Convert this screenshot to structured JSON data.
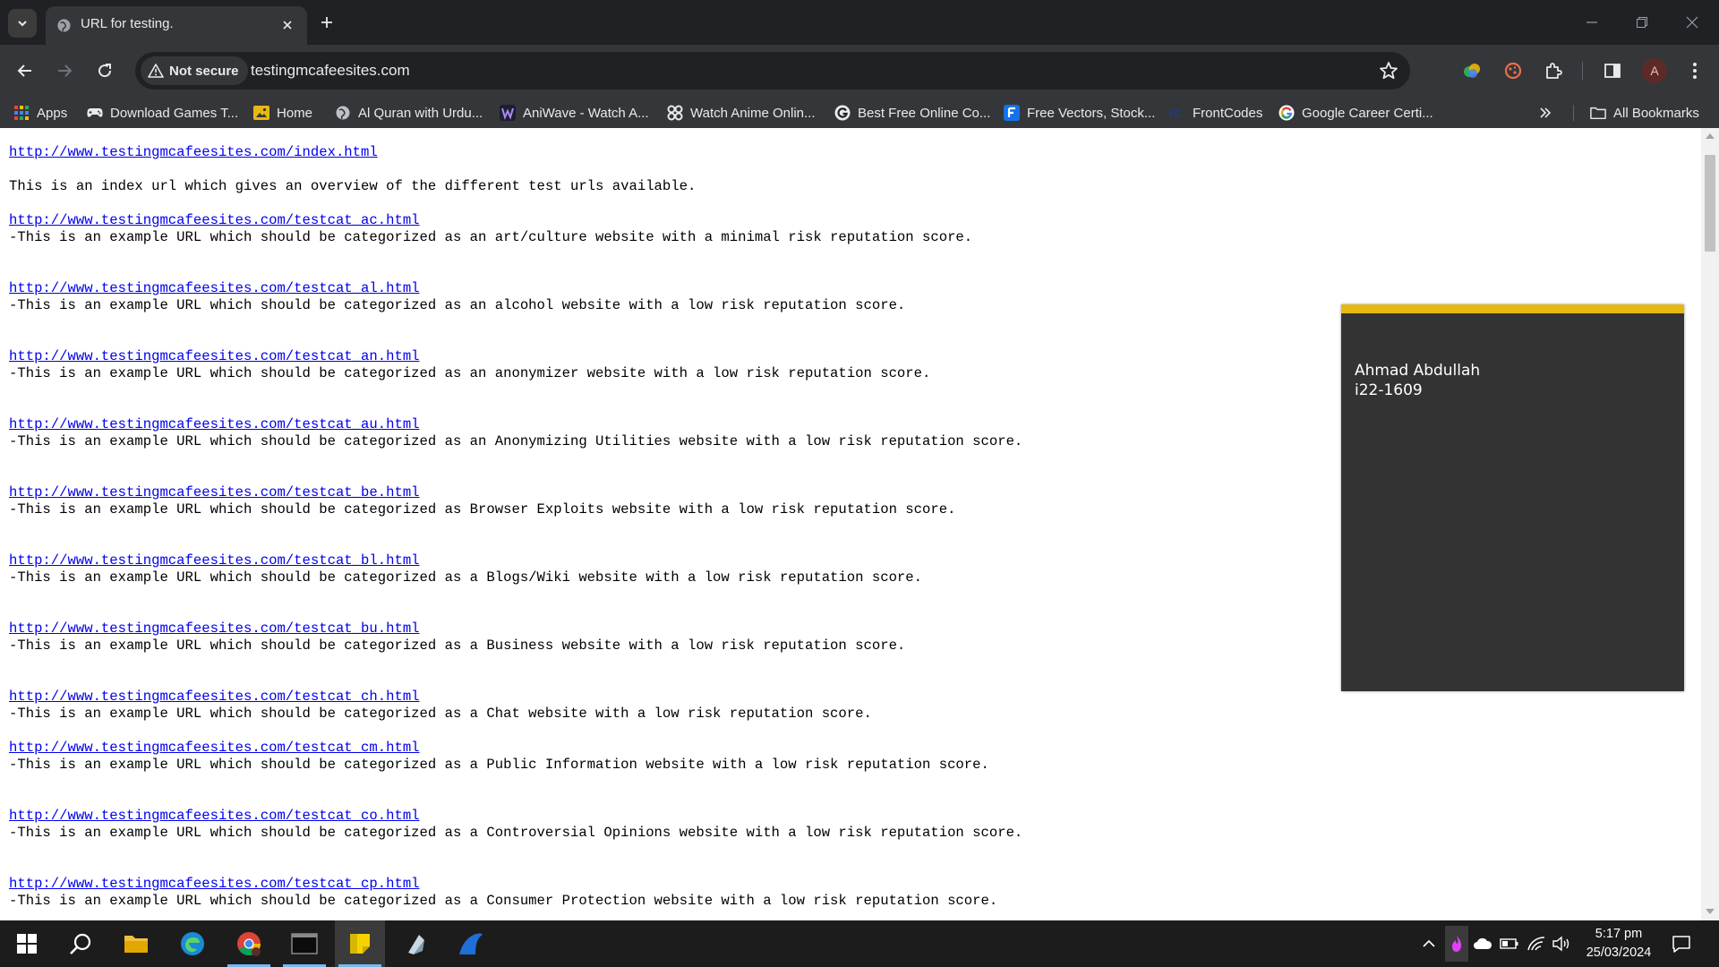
{
  "browser": {
    "tab_title": "URL for testing.",
    "security_chip": "Not secure",
    "url": "testingmcafeesites.com",
    "profile_initial": "A"
  },
  "bookmarks": {
    "items": [
      {
        "label": "Apps",
        "icon": "apps-grid-icon"
      },
      {
        "label": "Download Games T...",
        "icon": "gamepad-icon"
      },
      {
        "label": "Home",
        "icon": "home-image-icon"
      },
      {
        "label": "Al Quran with Urdu...",
        "icon": "globe-icon"
      },
      {
        "label": "AniWave - Watch A...",
        "icon": "aniwave-icon"
      },
      {
        "label": "Watch Anime Onlin...",
        "icon": "anime-icon"
      },
      {
        "label": "Best Free Online Co...",
        "icon": "google-g-icon"
      },
      {
        "label": "Free Vectors, Stock...",
        "icon": "freepik-icon"
      },
      {
        "label": "FrontCodes",
        "icon": "frontcodes-icon"
      },
      {
        "label": "Google Career Certi...",
        "icon": "google-icon"
      }
    ],
    "all_bookmarks": "All Bookmarks"
  },
  "page": {
    "entries": [
      {
        "url": "http://www.testingmcafeesites.com/index.html",
        "desc": "This is an index url which gives an overview of the different test urls available."
      },
      {
        "url": "http://www.testingmcafeesites.com/testcat_ac.html",
        "desc": "-This is an example URL which should be categorized as an art/culture website with a minimal risk reputation score."
      },
      {
        "url": "http://www.testingmcafeesites.com/testcat_al.html",
        "desc": "-This is an example URL which should be categorized as an alcohol website with a low risk reputation score."
      },
      {
        "url": "http://www.testingmcafeesites.com/testcat_an.html",
        "desc": "-This is an example URL which should be categorized as an anonymizer website with a low risk reputation score."
      },
      {
        "url": "http://www.testingmcafeesites.com/testcat_au.html",
        "desc": "-This is an example URL which should be categorized as an Anonymizing Utilities website with a low risk reputation score."
      },
      {
        "url": "http://www.testingmcafeesites.com/testcat_be.html",
        "desc": "-This is an example URL which should be categorized as Browser Exploits website with a low risk reputation score."
      },
      {
        "url": "http://www.testingmcafeesites.com/testcat_bl.html",
        "desc": "-This is an example URL which should be categorized as a Blogs/Wiki website with a low risk reputation score."
      },
      {
        "url": "http://www.testingmcafeesites.com/testcat_bu.html",
        "desc": "-This is an example URL which should be categorized as a Business website with a low risk reputation score."
      },
      {
        "url": "http://www.testingmcafeesites.com/testcat_ch.html",
        "desc": "-This is an example URL which should be categorized as a Chat website with a low risk reputation score."
      },
      {
        "url": "http://www.testingmcafeesites.com/testcat_cm.html",
        "desc": "-This is an example URL which should be categorized as a Public Information website with a low risk reputation score."
      },
      {
        "url": "http://www.testingmcafeesites.com/testcat_co.html",
        "desc": "-This is an example URL which should be categorized as a Controversial Opinions website with a low risk reputation score."
      },
      {
        "url": "http://www.testingmcafeesites.com/testcat_cp.html",
        "desc": "-This is an example URL which should be categorized as a Consumer Protection website with a low risk reputation score."
      }
    ]
  },
  "overlay": {
    "name": "Ahmad Abdullah",
    "id": "i22-1609"
  },
  "taskbar": {
    "time": "5:17 pm",
    "date": "25/03/2024"
  },
  "colors": {
    "link": "#0000ee",
    "card_accent": "#e6b812",
    "card_bg": "#333333"
  }
}
